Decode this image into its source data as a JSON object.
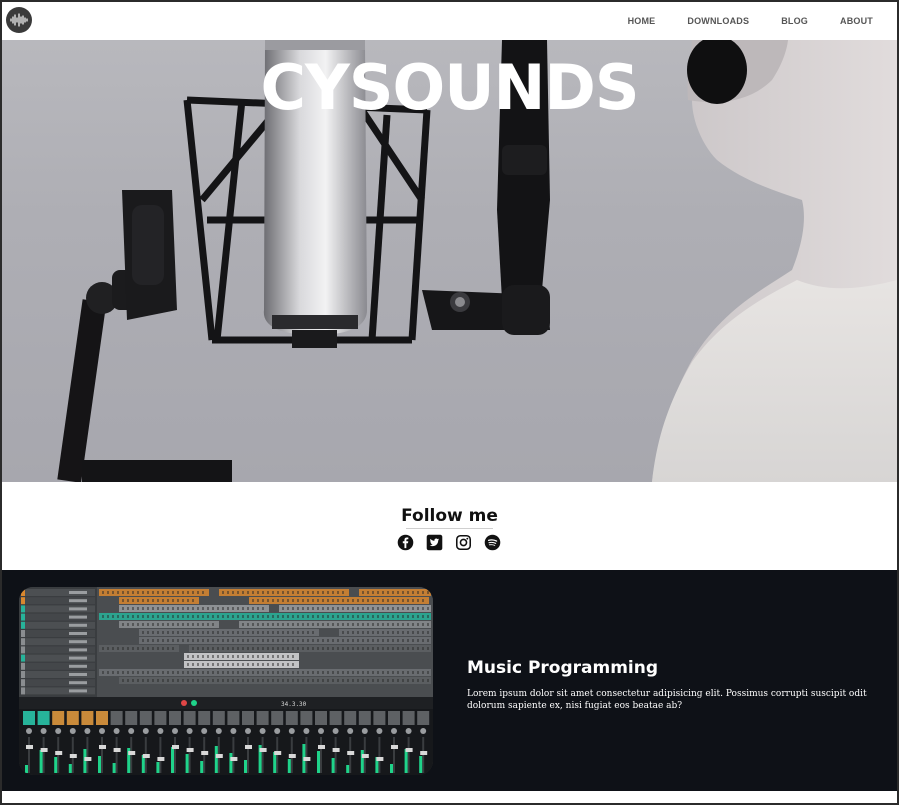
{
  "nav": {
    "logo_icon": "soundwave-icon",
    "links": [
      "HOME",
      "DOWNLOADS",
      "BLOG",
      "ABOUT"
    ]
  },
  "hero": {
    "title": "CYSOUNDS"
  },
  "follow": {
    "title": "Follow me",
    "icons": [
      "facebook-icon",
      "twitter-icon",
      "instagram-icon",
      "spotify-icon"
    ]
  },
  "music": {
    "title": "Music Programming",
    "text": "Lorem ipsum dolor sit amet consectetur adipisicing elit. Possimus corrupti suscipit odit dolorum sapiente ex, nisi fugiat eos beatae ab?",
    "daw_timecode": "34.3.30"
  },
  "colors": {
    "dark_bg": "#0e1117",
    "accent_green": "#1fd38a",
    "accent_orange": "#d9872e",
    "accent_teal": "#27b39a"
  }
}
